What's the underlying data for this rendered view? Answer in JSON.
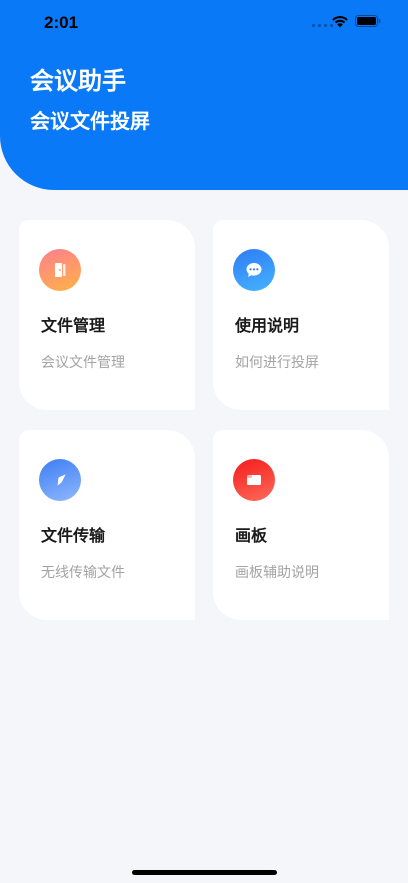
{
  "status_bar": {
    "time": "2:01"
  },
  "header": {
    "title": "会议助手",
    "subtitle": "会议文件投屏",
    "color": "#0a79f7"
  },
  "cards": [
    {
      "title": "文件管理",
      "desc": "会议文件管理",
      "icon": "door-icon",
      "gradient": [
        "#ff7e8e",
        "#ffb347"
      ]
    },
    {
      "title": "使用说明",
      "desc": "如何进行投屏",
      "icon": "chat-bubble-icon",
      "gradient": [
        "#2f7bf5",
        "#45b3ff"
      ]
    },
    {
      "title": "文件传输",
      "desc": "无线传输文件",
      "icon": "compass-icon",
      "gradient": [
        "#3d7df2",
        "#8fb8ff"
      ]
    },
    {
      "title": "画板",
      "desc": "画板辅助说明",
      "icon": "whiteboard-icon",
      "gradient": [
        "#f41c1c",
        "#ff6a5a"
      ]
    }
  ]
}
